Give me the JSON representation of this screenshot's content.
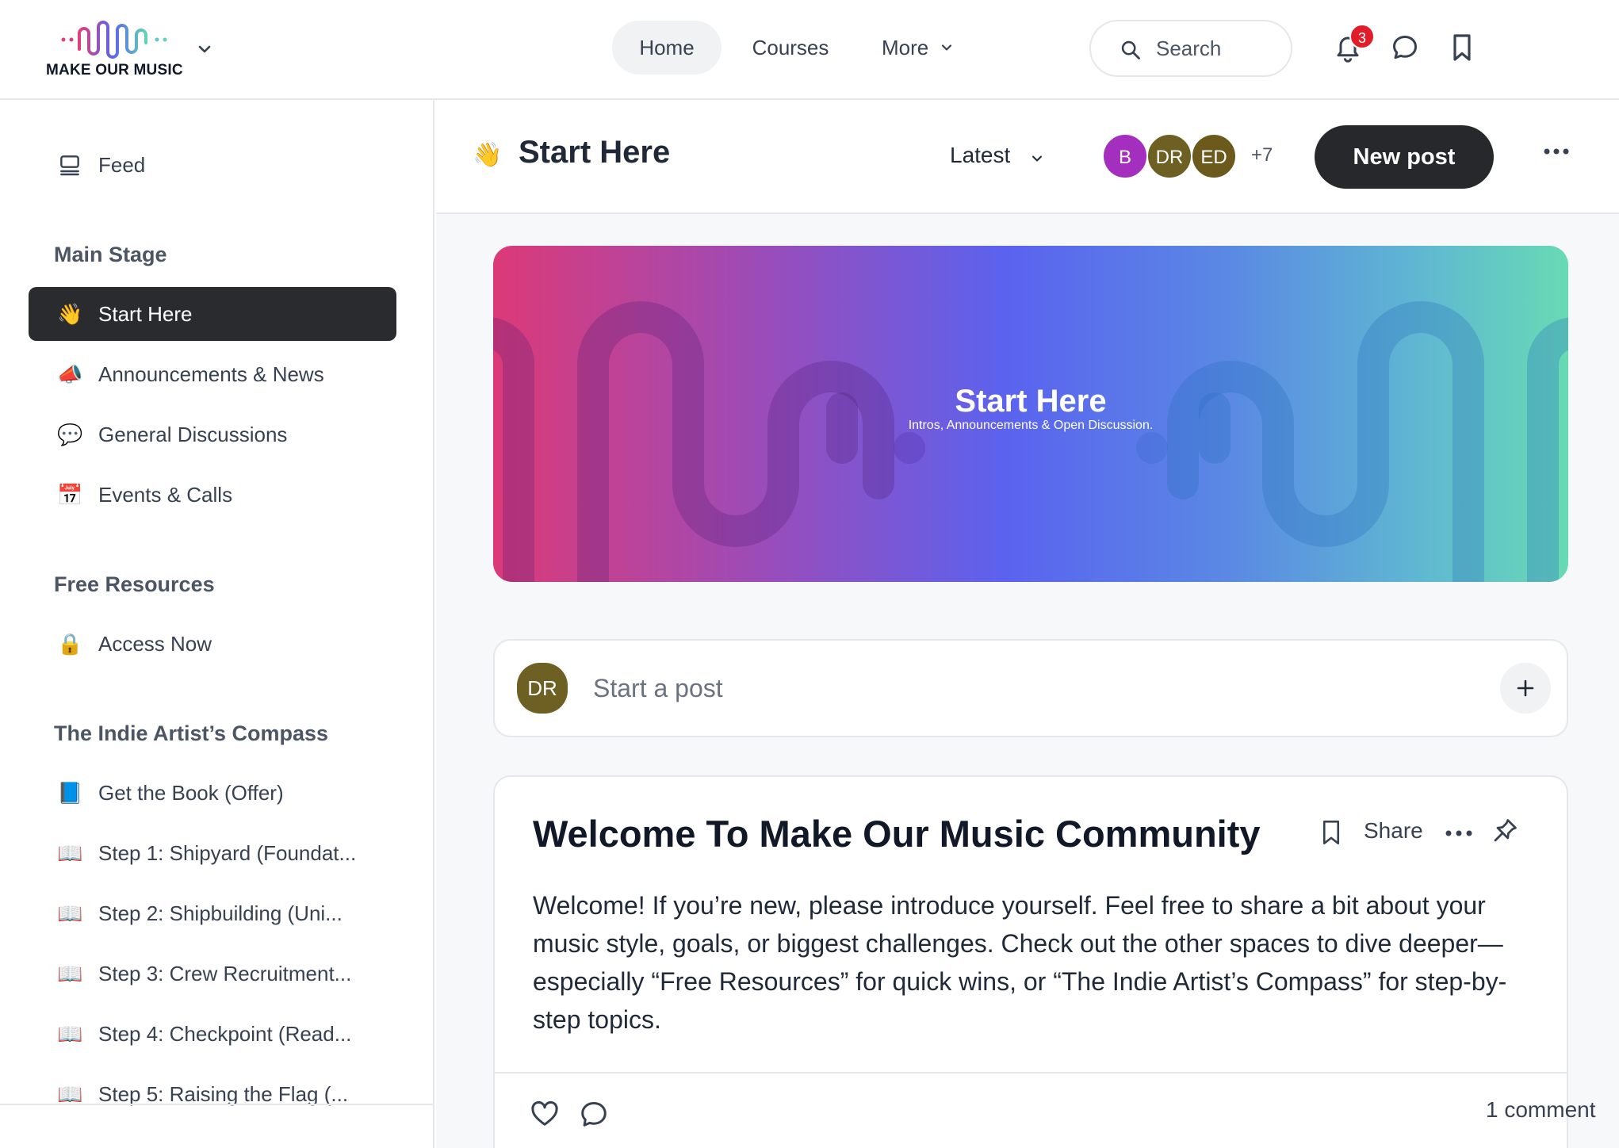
{
  "header": {
    "logo_text": "MAKE OUR MUSIC",
    "nav": {
      "home": "Home",
      "courses": "Courses",
      "more": "More"
    },
    "search_label": "Search",
    "notification_count": "3"
  },
  "sidebar": {
    "feed_label": "Feed",
    "sections": [
      {
        "title": "Main Stage"
      },
      {
        "title": "Free Resources"
      },
      {
        "title": "The Indie Artist’s Compass"
      }
    ],
    "items": [
      {
        "emoji": "👋",
        "label": "Start Here"
      },
      {
        "emoji": "📣",
        "label": "Announcements & News"
      },
      {
        "emoji": "💬",
        "label": "General Discussions"
      },
      {
        "emoji": "📅",
        "label": "Events & Calls"
      },
      {
        "emoji": "🔒",
        "label": "Access Now"
      },
      {
        "emoji": "📘",
        "label": "Get the Book (Offer)"
      },
      {
        "emoji": "📖",
        "label": "Step 1: Shipyard (Foundat..."
      },
      {
        "emoji": "📖",
        "label": "Step 2: Shipbuilding (Uni..."
      },
      {
        "emoji": "📖",
        "label": "Step 3: Crew Recruitment..."
      },
      {
        "emoji": "📖",
        "label": "Step 4: Checkpoint (Read..."
      },
      {
        "emoji": "📖",
        "label": "Step 5: Raising the Flag (..."
      }
    ]
  },
  "page": {
    "emoji": "👋",
    "title": "Start Here",
    "sort_label": "Latest",
    "members": [
      {
        "initials": "B",
        "color": "#a42fbf"
      },
      {
        "initials": "DR",
        "color": "#6e5f22"
      },
      {
        "initials": "ED",
        "color": "#6b5a1c"
      }
    ],
    "more_members": "+7",
    "new_post_label": "New post"
  },
  "banner": {
    "title": "Start Here",
    "subtitle": "Intros, Announcements & Open Discussion."
  },
  "composer": {
    "avatar_initials": "DR",
    "placeholder": "Start a post"
  },
  "post": {
    "title": "Welcome To Make Our Music Community",
    "share_label": "Share",
    "body": "Welcome! If you’re new, please introduce yourself. Feel free to share a bit about your music style, goals, or biggest challenges. Check out the other spaces to dive deeper—especially “Free Resources” for quick wins, or “The Indie Artist’s Compass” for step-by-step topics.",
    "comment_count": "1 comment"
  },
  "colors": {
    "active_bg": "#2a2b2e",
    "primary_button": "#27282b",
    "badge": "#e11d2a"
  }
}
